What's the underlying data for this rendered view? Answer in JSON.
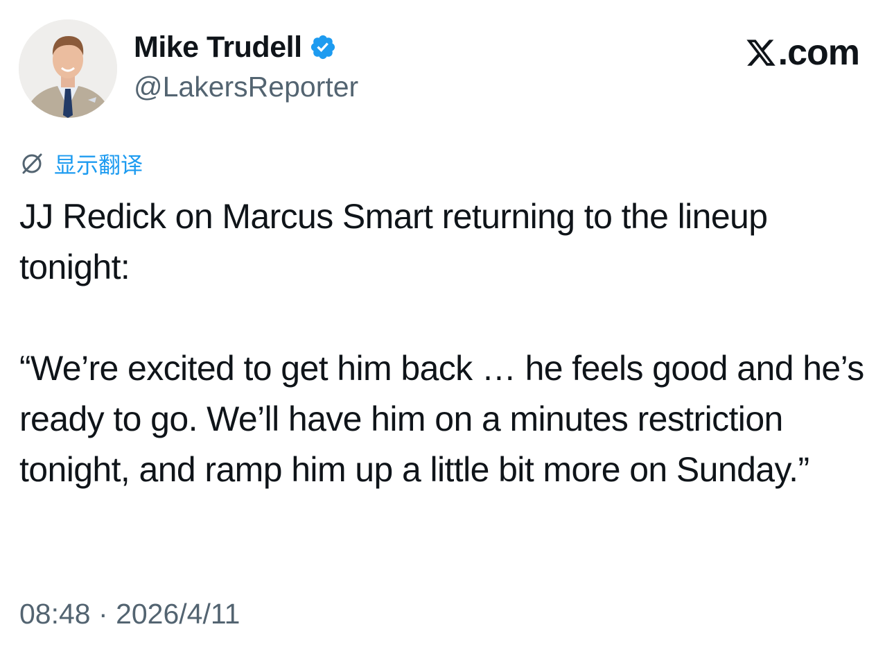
{
  "author": {
    "display_name": "Mike Trudell",
    "handle": "@LakersReporter",
    "verified": true
  },
  "brand": {
    "text": ".com",
    "icon": "x-logo-icon"
  },
  "translate": {
    "label": "显示翻译",
    "icon": "translate-icon"
  },
  "tweet": {
    "line1": "JJ Redick on Marcus Smart returning to the lineup tonight:",
    "line2": "“We’re excited to get him back … he feels good and he’s ready to go. We’ll have him on a minutes restriction tonight, and ramp him up a little bit more on Sunday.”"
  },
  "meta": {
    "time": "08:48",
    "separator": "·",
    "date": "2026/4/11"
  },
  "colors": {
    "text": "#0f1419",
    "secondary": "#536471",
    "accent": "#1d9bf0"
  }
}
